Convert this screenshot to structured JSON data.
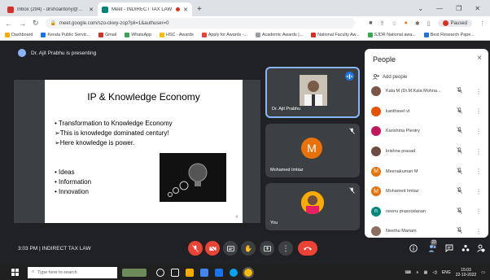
{
  "browser": {
    "tabs": [
      {
        "title": "Inbox (294) - drshoantony@MAII",
        "active": false,
        "favicon_color": "#d93025"
      },
      {
        "title": "Meet - INDIRECT TAX LAW",
        "active": true,
        "favicon_color": "#00897b"
      }
    ],
    "new_tab": "+",
    "url": "meet.google.com/szo-ckwy-zop?pli=1&authuser=0",
    "profile_status": "Paused",
    "bookmarks": [
      {
        "label": "Dashboard",
        "color": "#f9ab00"
      },
      {
        "label": "Kerala Public Servic...",
        "color": "#1a73e8"
      },
      {
        "label": "Gmail",
        "color": "#d93025"
      },
      {
        "label": "WhatsApp",
        "color": "#34a853"
      },
      {
        "label": "HSC - Awards",
        "color": "#fbbc04"
      },
      {
        "label": "Apply for Awards -...",
        "color": "#ea4335"
      },
      {
        "label": "Academic Awards |...",
        "color": "#9aa0a6"
      },
      {
        "label": "National Faculty Aw...",
        "color": "#d93025"
      },
      {
        "label": "SJDR National awa...",
        "color": "#34a853"
      },
      {
        "label": "Best Research Pape...",
        "color": "#1a73e8"
      }
    ]
  },
  "meet": {
    "presenter_banner": "Dr. Ajit Prabhu is presenting",
    "slide": {
      "title": "IP & Knowledge Economy",
      "bullets": [
        "Transformation to Knowledge Economy",
        "This is knowledge dominated century!",
        "Here knowledge is power."
      ],
      "bullets2": [
        "Ideas",
        "Information",
        "Innovation"
      ],
      "footer": "4"
    },
    "tiles": [
      {
        "name": "Dr. Ajit Prabhu"
      },
      {
        "name": "Mohamed Imtiaz",
        "initial": "M"
      },
      {
        "name": "You"
      }
    ],
    "meeting_time": "3:03 PM",
    "meeting_separator": "|",
    "meeting_name": "INDIRECT TAX LAW",
    "participant_count": "22"
  },
  "people": {
    "title": "People",
    "close": "×",
    "add_people": "Add people",
    "participants": [
      {
        "name": "Kala M (Dr.M.Kala Mohna...",
        "color": "#795548",
        "initial": ""
      },
      {
        "name": "kanthavel vt",
        "color": "#e65100",
        "initial": ""
      },
      {
        "name": "Karishma Plentry",
        "color": "#c2185b",
        "initial": ""
      },
      {
        "name": "krishna prasad",
        "color": "#6d4c41",
        "initial": ""
      },
      {
        "name": "Meenakumari M",
        "color": "#e8710a",
        "initial": "M"
      },
      {
        "name": "Mohamed Imtiaz",
        "color": "#e8710a",
        "initial": "M"
      },
      {
        "name": "neenu prasoodanan",
        "color": "#00897b",
        "initial": "n"
      },
      {
        "name": "Neethu Mariam",
        "color": "#8d6e63",
        "initial": ""
      }
    ]
  },
  "taskbar": {
    "search_placeholder": "Type here to search",
    "lang": "ENG",
    "time": "15:03",
    "date": "22-10-2022"
  }
}
